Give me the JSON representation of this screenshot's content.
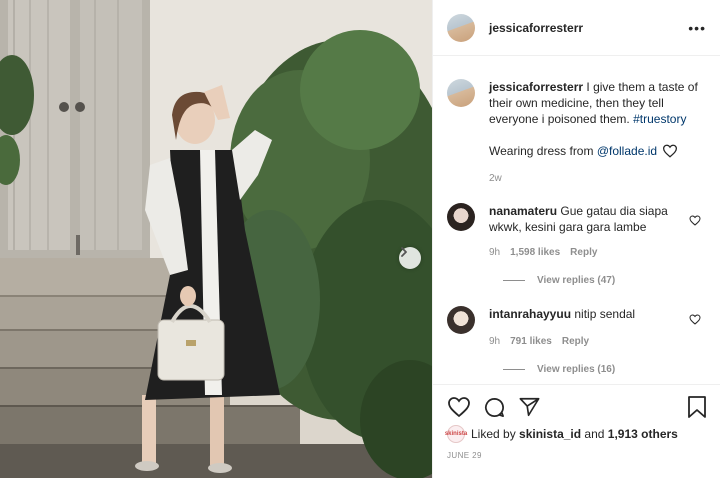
{
  "post": {
    "author": "jessicaforresterr",
    "caption_text": "I give them a taste of their own medicine, then they tell everyone i poisoned them.",
    "hashtag": "#truestory",
    "caption_line2_prefix": "Wearing dress from",
    "mention": "@follade.id",
    "caption_time": "2w",
    "more_label": "•••"
  },
  "comments": [
    {
      "username": "nanamateru",
      "text": "Gue gatau dia siapa wkwk, kesini gara gara lambe",
      "time": "9h",
      "likes": "1,598 likes",
      "reply_label": "Reply",
      "view_replies": "View replies (47)"
    },
    {
      "username": "intanrahayyuu",
      "text": "nitip sendal",
      "time": "9h",
      "likes": "791 likes",
      "reply_label": "Reply",
      "view_replies": "View replies (16)"
    }
  ],
  "footer": {
    "liked_by_prefix": "Liked by",
    "liked_by_user": "skinista_id",
    "liked_by_and": "and",
    "liked_by_count": "1,913 others",
    "liker_badge": "skinista",
    "date": "JUNE 29"
  },
  "icons": {
    "like": "heart-icon",
    "comment": "comment-icon",
    "share": "paper-plane-icon",
    "save": "bookmark-icon",
    "next": "chevron-right-icon",
    "more": "more-horizontal-icon"
  }
}
